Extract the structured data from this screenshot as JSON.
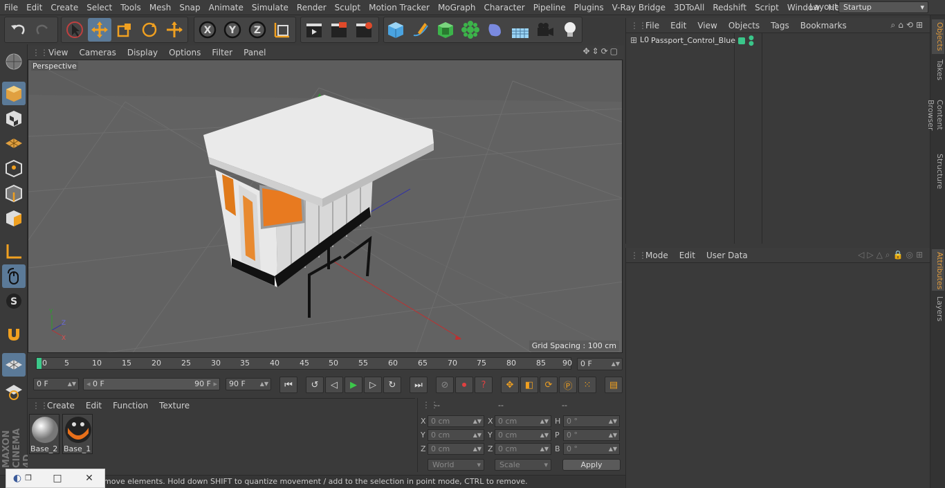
{
  "menubar": {
    "items": [
      "File",
      "Edit",
      "Create",
      "Select",
      "Tools",
      "Mesh",
      "Snap",
      "Animate",
      "Simulate",
      "Render",
      "Sculpt",
      "Motion Tracker",
      "MoGraph",
      "Character",
      "Pipeline",
      "Plugins",
      "V-Ray Bridge",
      "3DToAll",
      "Redshift",
      "Script",
      "Window",
      "Help"
    ],
    "layout_label": "Layout:",
    "layout_value": "Startup"
  },
  "viewport": {
    "menu": [
      "View",
      "Cameras",
      "Display",
      "Options",
      "Filter",
      "Panel"
    ],
    "label": "Perspective",
    "grid_spacing": "Grid Spacing : 100 cm"
  },
  "timeline": {
    "ticks": [
      "0",
      "5",
      "10",
      "15",
      "20",
      "25",
      "30",
      "35",
      "40",
      "45",
      "50",
      "55",
      "60",
      "65",
      "70",
      "75",
      "80",
      "85",
      "90"
    ],
    "current_frame": "0 F",
    "start_field": "0 F",
    "range_start": "0 F",
    "range_end": "90 F",
    "end_field": "90 F"
  },
  "material_manager": {
    "menu": [
      "Create",
      "Edit",
      "Function",
      "Texture"
    ],
    "materials": [
      {
        "name": "Base_2"
      },
      {
        "name": "Base_1"
      }
    ]
  },
  "coordinates": {
    "header": [
      "--",
      "--",
      "--"
    ],
    "rows": [
      {
        "a_label": "X",
        "a_value": "0 cm",
        "b_label": "X",
        "b_value": "0 cm",
        "c_label": "H",
        "c_value": "0 °"
      },
      {
        "a_label": "Y",
        "a_value": "0 cm",
        "b_label": "Y",
        "b_value": "0 cm",
        "c_label": "P",
        "c_value": "0 °"
      },
      {
        "a_label": "Z",
        "a_value": "0 cm",
        "b_label": "Z",
        "b_value": "0 cm",
        "c_label": "B",
        "c_value": "0 °"
      }
    ],
    "world": "World",
    "scale": "Scale",
    "apply": "Apply"
  },
  "status": {
    "text": "move elements. Hold down SHIFT to quantize movement / add to the selection in point mode, CTRL to remove."
  },
  "object_manager": {
    "menu": [
      "File",
      "Edit",
      "View",
      "Objects",
      "Tags",
      "Bookmarks"
    ],
    "objects": [
      {
        "name": "Passport_Control_Blue"
      }
    ]
  },
  "attribute_manager": {
    "menu": [
      "Mode",
      "Edit",
      "User Data"
    ]
  },
  "right_tabs": [
    "Objects",
    "Takes",
    "Content Browser",
    "Structure"
  ],
  "right_tabs_lower": [
    "Attributes",
    "Layers"
  ],
  "brand": "MAXON CINEMA 4D",
  "colors": {
    "accent": "#5b7a98",
    "tab_active": "#e09a3c",
    "obj_tag": "#3ac68a"
  }
}
